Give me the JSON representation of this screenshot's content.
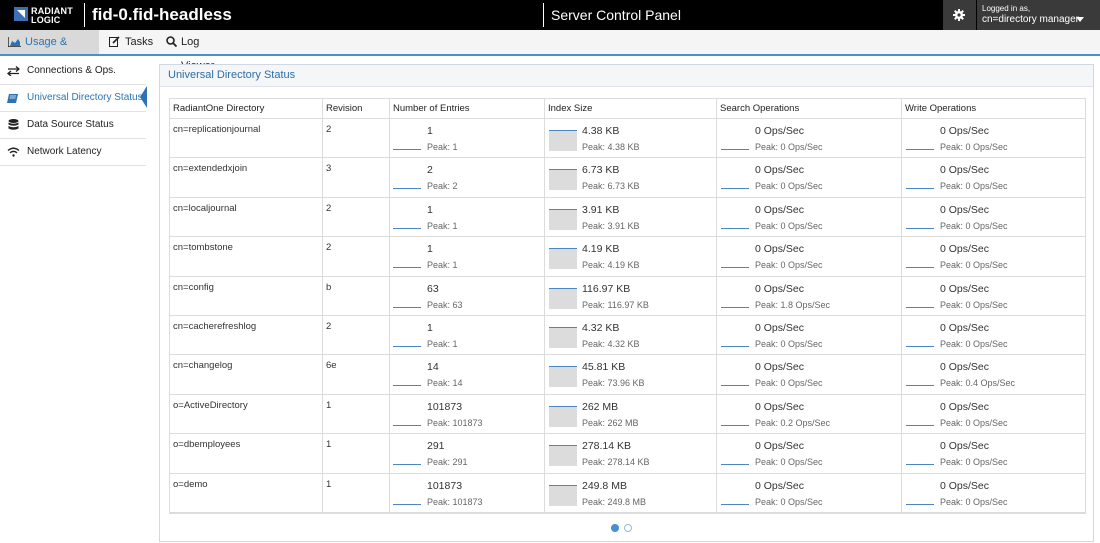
{
  "header": {
    "logo_line1": "RADIANT",
    "logo_line2": "LOGIC",
    "hostname": "fid-0.fid-headless",
    "panel_title": "Server Control Panel",
    "logged_in_label": "Logged in as,",
    "user": "cn=directory manager"
  },
  "nav": {
    "tabs": [
      {
        "label": "Usage & Activity",
        "icon": "area-chart-icon",
        "active": true
      },
      {
        "label": "Tasks",
        "icon": "edit-icon",
        "active": false
      },
      {
        "label": "Log Viewer",
        "icon": "search-icon",
        "active": false
      }
    ]
  },
  "sidebar": {
    "items": [
      {
        "label": "Connections & Ops.",
        "icon": "arrows-exchange-icon",
        "active": false
      },
      {
        "label": "Universal Directory Status",
        "icon": "book-icon",
        "active": true
      },
      {
        "label": "Data Source Status",
        "icon": "database-icon",
        "active": false
      },
      {
        "label": "Network Latency",
        "icon": "wifi-icon",
        "active": false
      }
    ]
  },
  "main": {
    "title": "Universal Directory Status",
    "columns": [
      "RadiantOne Directory",
      "Revision",
      "Number of Entries",
      "Index Size",
      "Search Operations",
      "Write Operations"
    ],
    "rows": [
      {
        "name": "cn=replicationjournal",
        "revision": "2",
        "entries": "1",
        "entries_peak": "Peak: 1",
        "index": "4.38 KB",
        "index_peak": "Peak: 4.38 KB",
        "search": "0 Ops/Sec",
        "search_peak": "Peak: 0 Ops/Sec",
        "write": "0 Ops/Sec",
        "write_peak": "Peak: 0 Ops/Sec"
      },
      {
        "name": "cn=extendedxjoin",
        "revision": "3",
        "entries": "2",
        "entries_peak": "Peak: 2",
        "index": "6.73 KB",
        "index_peak": "Peak: 6.73 KB",
        "search": "0 Ops/Sec",
        "search_peak": "Peak: 0 Ops/Sec",
        "write": "0 Ops/Sec",
        "write_peak": "Peak: 0 Ops/Sec"
      },
      {
        "name": "cn=localjournal",
        "revision": "2",
        "entries": "1",
        "entries_peak": "Peak: 1",
        "index": "3.91 KB",
        "index_peak": "Peak: 3.91 KB",
        "search": "0 Ops/Sec",
        "search_peak": "Peak: 0 Ops/Sec",
        "write": "0 Ops/Sec",
        "write_peak": "Peak: 0 Ops/Sec"
      },
      {
        "name": "cn=tombstone",
        "revision": "2",
        "entries": "1",
        "entries_peak": "Peak: 1",
        "index": "4.19 KB",
        "index_peak": "Peak: 4.19 KB",
        "search": "0 Ops/Sec",
        "search_peak": "Peak: 0 Ops/Sec",
        "write": "0 Ops/Sec",
        "write_peak": "Peak: 0 Ops/Sec"
      },
      {
        "name": "cn=config",
        "revision": "b",
        "entries": "63",
        "entries_peak": "Peak: 63",
        "index": "116.97 KB",
        "index_peak": "Peak: 116.97 KB",
        "search": "0 Ops/Sec",
        "search_peak": "Peak: 1.8 Ops/Sec",
        "write": "0 Ops/Sec",
        "write_peak": "Peak: 0 Ops/Sec"
      },
      {
        "name": "cn=cacherefreshlog",
        "revision": "2",
        "entries": "1",
        "entries_peak": "Peak: 1",
        "index": "4.32 KB",
        "index_peak": "Peak: 4.32 KB",
        "search": "0 Ops/Sec",
        "search_peak": "Peak: 0 Ops/Sec",
        "write": "0 Ops/Sec",
        "write_peak": "Peak: 0 Ops/Sec"
      },
      {
        "name": "cn=changelog",
        "revision": "6e",
        "entries": "14",
        "entries_peak": "Peak: 14",
        "index": "45.81 KB",
        "index_peak": "Peak: 73.96 KB",
        "search": "0 Ops/Sec",
        "search_peak": "Peak: 0 Ops/Sec",
        "write": "0 Ops/Sec",
        "write_peak": "Peak: 0.4 Ops/Sec"
      },
      {
        "name": "o=ActiveDirectory",
        "revision": "1",
        "entries": "101873",
        "entries_peak": "Peak: 101873",
        "index": "262 MB",
        "index_peak": "Peak: 262 MB",
        "search": "0 Ops/Sec",
        "search_peak": "Peak: 0.2 Ops/Sec",
        "write": "0 Ops/Sec",
        "write_peak": "Peak: 0 Ops/Sec"
      },
      {
        "name": "o=dbemployees",
        "revision": "1",
        "entries": "291",
        "entries_peak": "Peak: 291",
        "index": "278.14 KB",
        "index_peak": "Peak: 278.14 KB",
        "search": "0 Ops/Sec",
        "search_peak": "Peak: 0 Ops/Sec",
        "write": "0 Ops/Sec",
        "write_peak": "Peak: 0 Ops/Sec"
      },
      {
        "name": "o=demo",
        "revision": "1",
        "entries": "101873",
        "entries_peak": "Peak: 101873",
        "index": "249.8 MB",
        "index_peak": "Peak: 249.8 MB",
        "search": "0 Ops/Sec",
        "search_peak": "Peak: 0 Ops/Sec",
        "write": "0 Ops/Sec",
        "write_peak": "Peak: 0 Ops/Sec"
      }
    ],
    "pager": {
      "pages": 2,
      "current": 1
    }
  },
  "colors": {
    "accent": "#2d73b3",
    "sparkline": "#4a87c2",
    "sparkline_alt": "#e59a3c",
    "topbar": "#000000"
  }
}
